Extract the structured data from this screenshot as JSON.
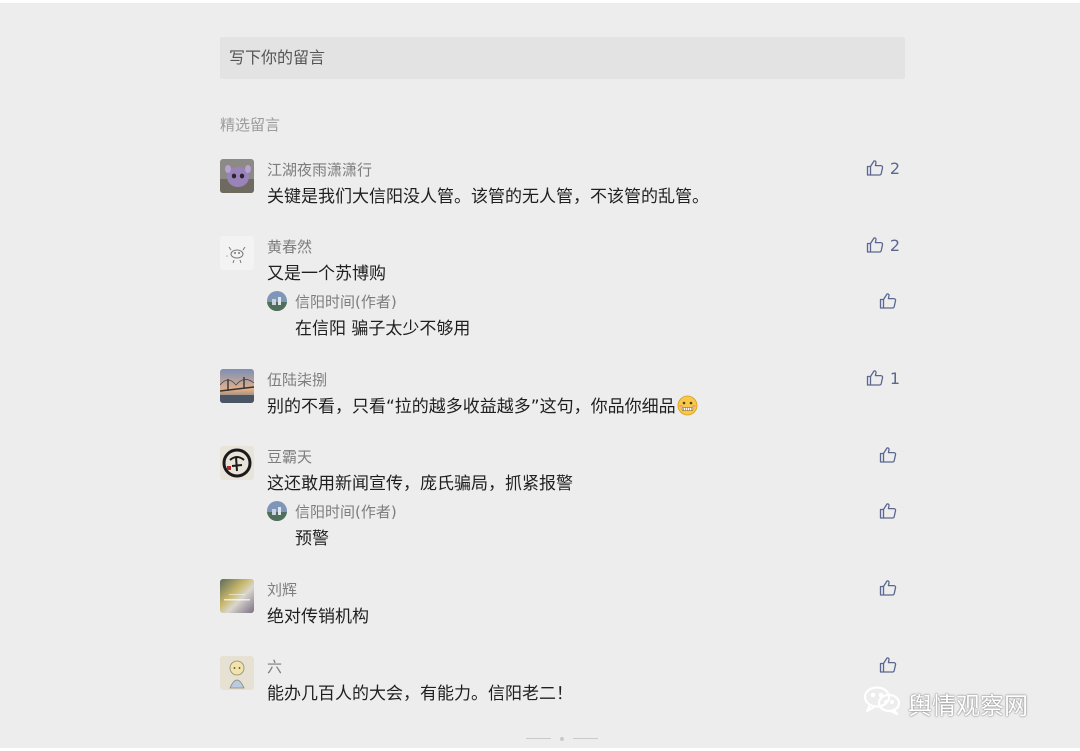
{
  "input": {
    "placeholder": "写下你的留言"
  },
  "section_title": "精选留言",
  "comments": [
    {
      "name": "江湖夜雨潇潇行",
      "text": "关键是我们大信阳没人管。该管的无人管，不该管的乱管。",
      "likes": "2",
      "avatar_icon": "purple-creature-avatar"
    },
    {
      "name": "黄春然",
      "text": "又是一个苏博购",
      "likes": "2",
      "avatar_icon": "doodle-avatar",
      "reply": {
        "name": "信阳时间(作者)",
        "text": "在信阳 骗子太少不够用"
      }
    },
    {
      "name": "伍陆柒捌",
      "text": "别的不看，只看“拉的越多收益越多”这句，你品你细品",
      "likes": "1",
      "avatar_icon": "bridge-photo-avatar",
      "emoji": "zipped-mouth-face-emoji"
    },
    {
      "name": "豆霸天",
      "text": "这还敢用新闻宣传，庞氏骗局，抓紧报警",
      "likes": "",
      "avatar_icon": "calligraphy-avatar",
      "reply": {
        "name": "信阳时间(作者)",
        "text": "预警"
      }
    },
    {
      "name": "刘辉",
      "text": "绝对传销机构",
      "likes": "",
      "avatar_icon": "rainbow-light-avatar"
    },
    {
      "name": "六",
      "text": "能办几百人的大会，有能力。信阳老二！",
      "likes": "",
      "avatar_icon": "cartoon-figure-avatar"
    }
  ],
  "watermark": {
    "text": "舆情观察网",
    "icon": "wechat-icon"
  },
  "colors": {
    "like": "#5b6790",
    "background": "#ededed",
    "input_bg": "#e3e3e3"
  }
}
